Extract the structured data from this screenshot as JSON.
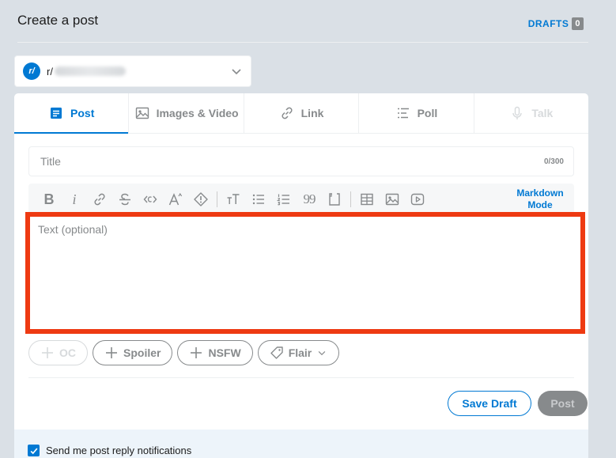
{
  "header": {
    "title": "Create a post",
    "drafts_label": "DRAFTS",
    "drafts_count": "0"
  },
  "community": {
    "icon_text": "r/",
    "prefix": "r/",
    "name_blurred": true
  },
  "tabs": [
    {
      "label": "Post",
      "icon": "post-icon",
      "state": "active"
    },
    {
      "label": "Images & Video",
      "icon": "image-icon",
      "state": "normal"
    },
    {
      "label": "Link",
      "icon": "link-icon",
      "state": "normal"
    },
    {
      "label": "Poll",
      "icon": "poll-icon",
      "state": "normal"
    },
    {
      "label": "Talk",
      "icon": "microphone-icon",
      "state": "disabled"
    }
  ],
  "title_field": {
    "placeholder": "Title",
    "value": "",
    "char_count": "0/300"
  },
  "toolbar": {
    "bold": "B",
    "italic": "i",
    "heading": "T",
    "quote": "99",
    "markdown_mode": "Markdown Mode"
  },
  "body_field": {
    "placeholder": "Text (optional)",
    "value": ""
  },
  "tags": {
    "oc": "OC",
    "spoiler": "Spoiler",
    "nsfw": "NSFW",
    "flair": "Flair"
  },
  "actions": {
    "save_draft": "Save Draft",
    "post": "Post"
  },
  "notifications": {
    "label": "Send me post reply notifications",
    "checked": true
  },
  "colors": {
    "accent": "#0079d3",
    "highlight_border": "#ee3a12",
    "background": "#dae0e6",
    "muted": "#878a8c"
  }
}
